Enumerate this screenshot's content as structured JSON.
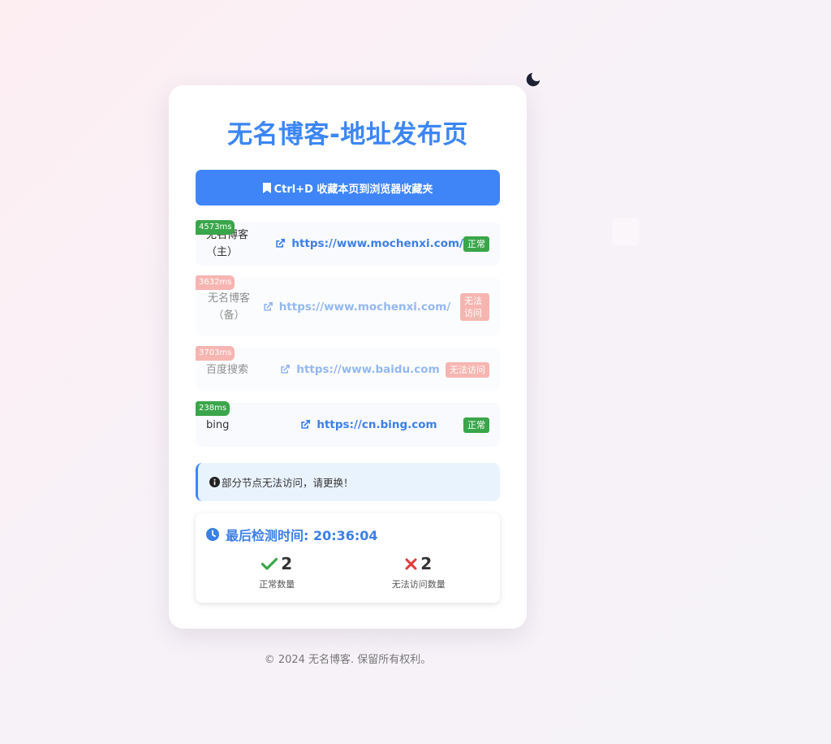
{
  "header": {
    "title": "无名博客-地址发布页",
    "theme_icon": "moon-icon"
  },
  "bookmark": {
    "label": "Ctrl+D 收藏本页到浏览器收藏夹",
    "icon": "bookmark-icon"
  },
  "nodes": [
    {
      "name": "无名博客（主）",
      "url": "https://www.mochenxi.com/",
      "latency": "4573ms",
      "status": "正常",
      "ok": true
    },
    {
      "name": "无名博客（备）",
      "url": "https://www.mochenxi.com/",
      "latency": "3632ms",
      "status": "无法访问",
      "ok": false
    },
    {
      "name": "百度搜索",
      "url": "https://www.baidu.com",
      "latency": "3703ms",
      "status": "无法访问",
      "ok": false
    },
    {
      "name": "bing",
      "url": "https://cn.bing.com",
      "latency": "238ms",
      "status": "正常",
      "ok": true
    }
  ],
  "notice": {
    "text": "部分节点无法访问，请更换！",
    "icon": "info-icon"
  },
  "check": {
    "title": "最后检测时间: 20:36:04",
    "icon": "clock-icon",
    "ok_count": "2",
    "ok_label": "正常数量",
    "fail_count": "2",
    "fail_label": "无法访问数量"
  },
  "footer": {
    "text": "© 2024 无名博客. 保留所有权利。"
  },
  "colors": {
    "accent": "#3f85f7",
    "ok": "#3aa54a",
    "bad": "#f07a72"
  }
}
